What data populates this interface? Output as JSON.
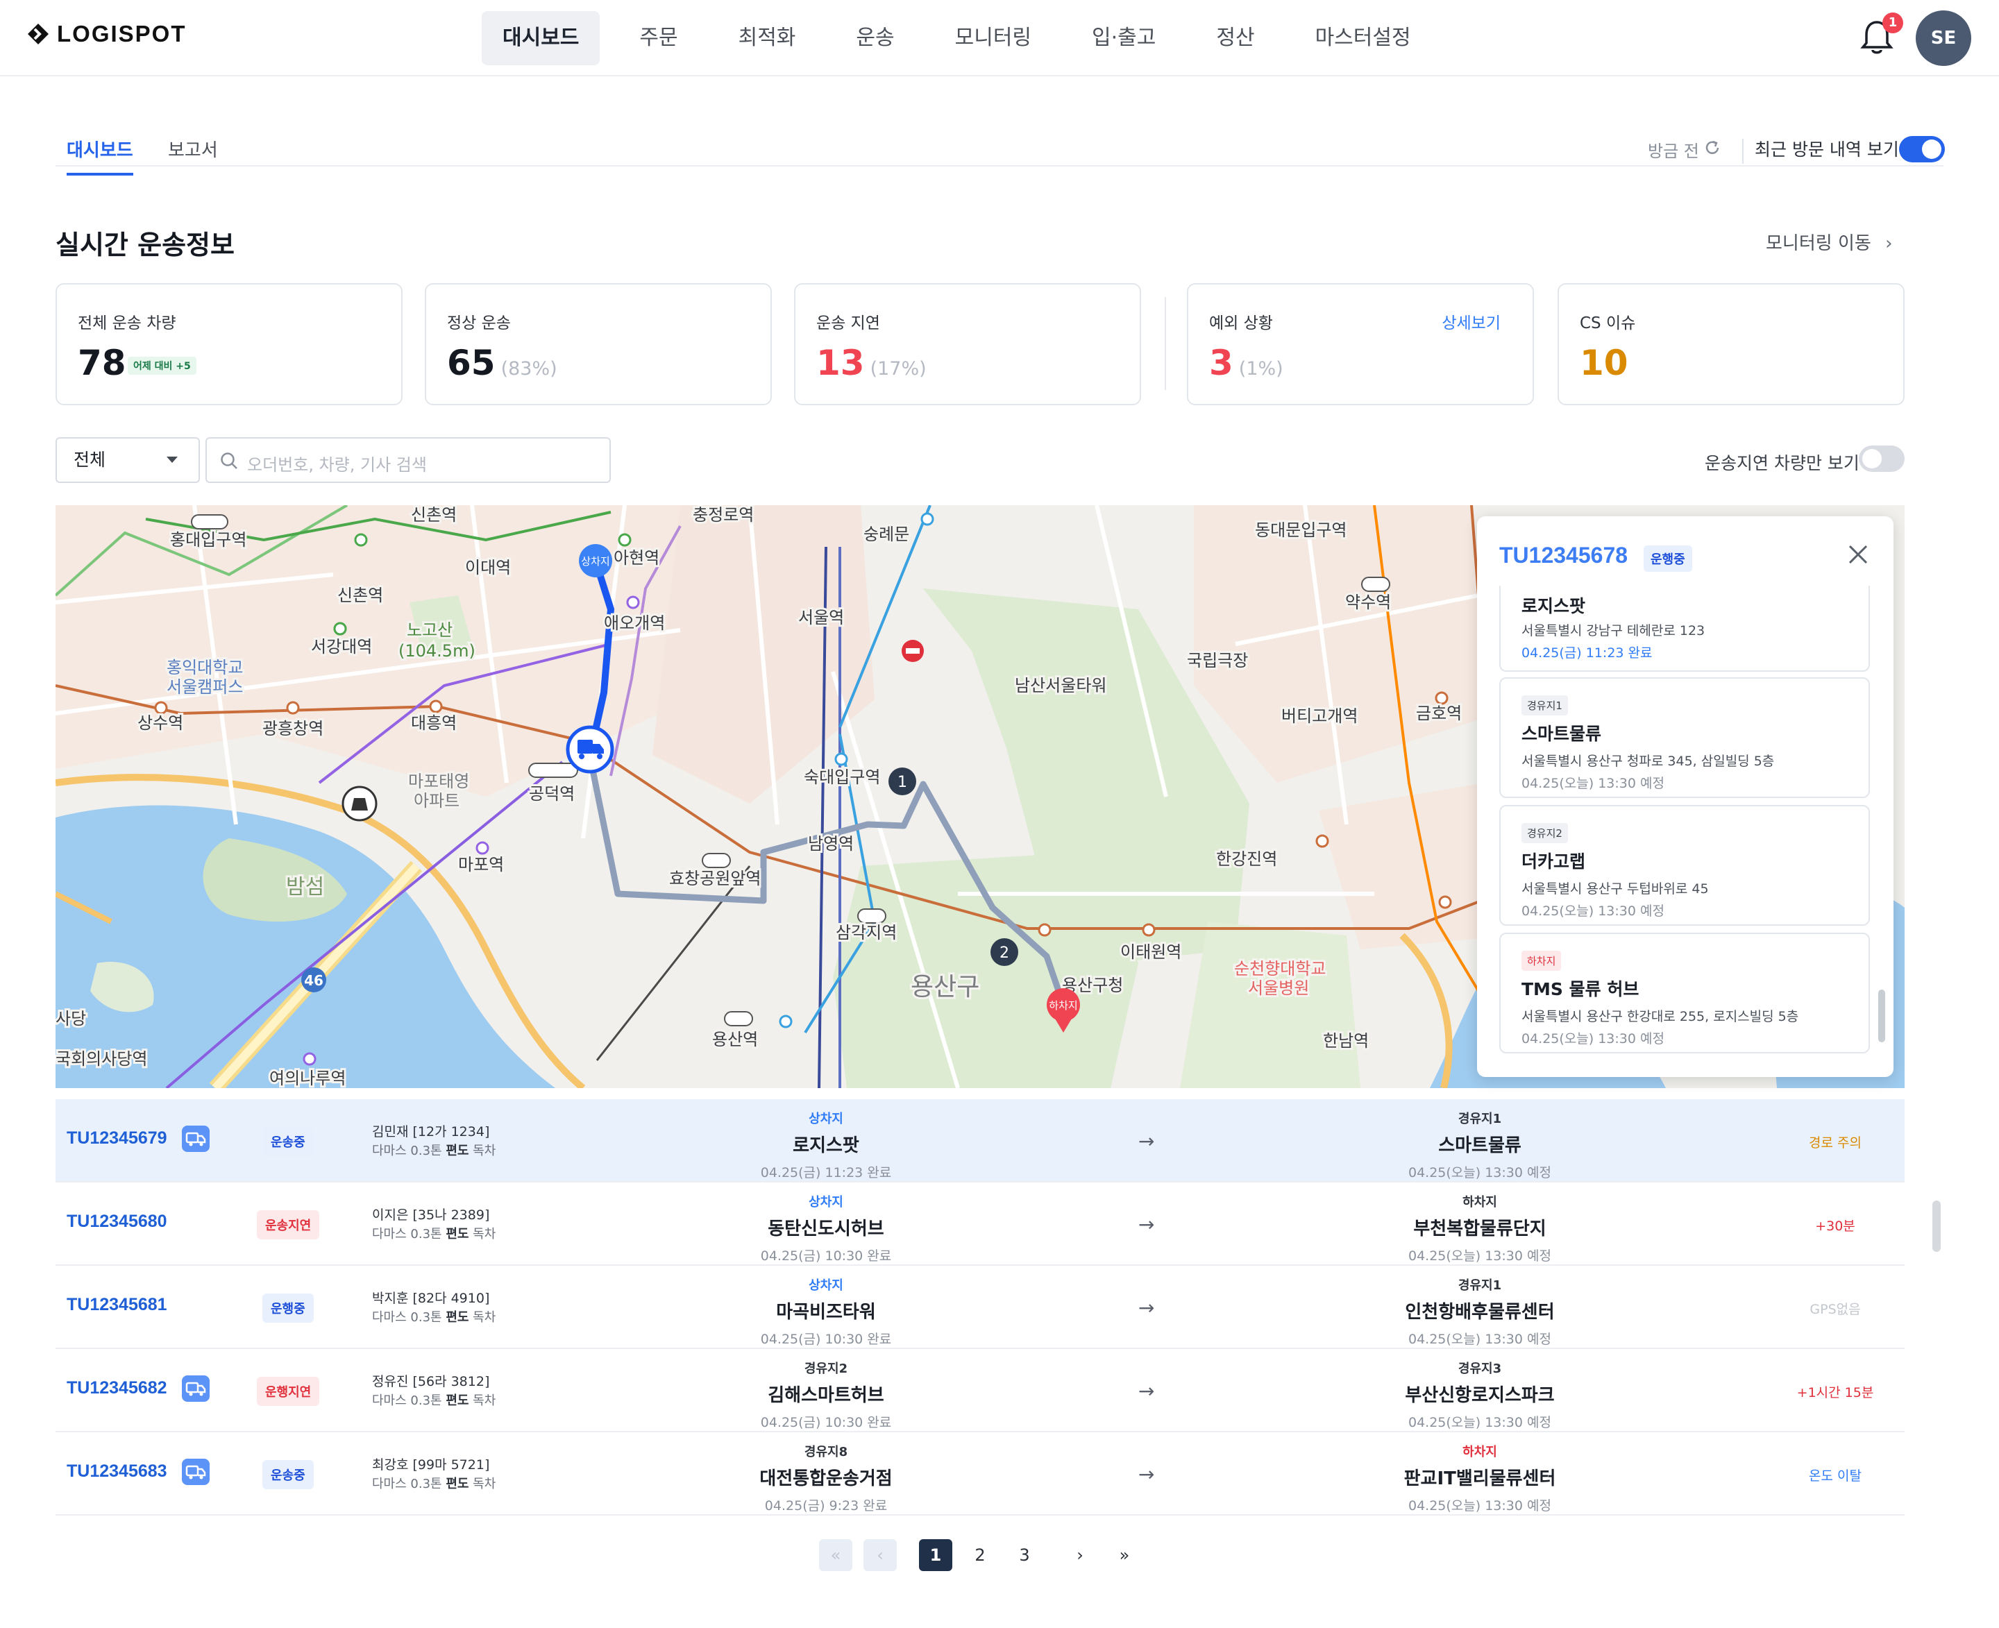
{
  "brand": {
    "name": "LOGISPOT"
  },
  "nav": {
    "items": [
      "대시보드",
      "주문",
      "최적화",
      "운송",
      "모니터링",
      "입·출고",
      "정산",
      "마스터설정"
    ],
    "notification_count": "1",
    "avatar_initials": "SE"
  },
  "subtabs": {
    "items": [
      "대시보드",
      "보고서"
    ],
    "active": "대시보드"
  },
  "refresh_label": "방금 전",
  "recent_visit": {
    "label": "최근 방문 내역 보기",
    "on": true
  },
  "section": {
    "title": "실시간 운송정보",
    "monitor_link": "모니터링 이동"
  },
  "kpis": {
    "total": {
      "label": "전체 운송 차량",
      "value": "78",
      "chip": "어제 대비 +5"
    },
    "normal": {
      "label": "정상 운송",
      "value": "65",
      "pct": "(83%)"
    },
    "delay": {
      "label": "운송 지연",
      "value": "13",
      "pct": "(17%)"
    },
    "exception": {
      "label": "예외 상황",
      "value": "3",
      "pct": "(1%)",
      "detail": "상세보기"
    },
    "cs": {
      "label": "CS 이슈",
      "value": "10"
    }
  },
  "filter": {
    "select": "전체",
    "search_placeholder": "오더번호, 차량, 기사 검색",
    "delay_only_label": "운송지연 차량만 보기",
    "delay_only_on": false
  },
  "map": {
    "labels": {
      "sinchon": "신촌역",
      "hongdae": "홍대입구역",
      "idae": "이대역",
      "sinchon2": "신촌역",
      "seogang": "서강대역",
      "nogosan": "노고산",
      "nogosan_h": "(104.5m)",
      "hongik": "홍익대학교",
      "hongik2": "서울캠퍼스",
      "sangsu": "상수역",
      "gwangheung": "광흥창역",
      "daeheung": "대흥역",
      "mapo_apt": "마포태영",
      "mapo_apt2": "아파트",
      "gongdeok": "공덕역",
      "bamseom": "밤섬",
      "mapo": "마포역",
      "yeouinaru": "여의나루역",
      "assembly": "국회의사당역",
      "sadang": "사당",
      "ahyeon": "아현역",
      "aeogae": "애오개역",
      "chungjeongno": "충정로역",
      "sungnyemun": "숭례문",
      "seoulst": "서울역",
      "sookmyung": "숙대입구역",
      "namyeong": "남영역",
      "hyochang": "효창공원앞역",
      "samgakji": "삼각지역",
      "yongsan": "용산역",
      "yongsangu": "용산구",
      "yongsangu_office": "용산구청",
      "itaewon": "이태원역",
      "namsan": "남산서울타워",
      "national_theater": "국립극장",
      "dongdaemun": "동대문입구역",
      "yaksu": "약수역",
      "beotigogae": "버티고개역",
      "geumho": "금호역",
      "hangangjin": "한강진역",
      "hannam": "한남역",
      "soonchunhyang": "순천향대학교",
      "soonchunhyang2": "서울병원",
      "line46": "46"
    },
    "markers": {
      "pickup": "상차지",
      "dropoff": "하차지",
      "stop1": "1",
      "stop2": "2"
    }
  },
  "panel": {
    "id": "TU12345678",
    "status": "운행중",
    "stops": [
      {
        "tag": "",
        "name": "로지스팟",
        "address": "서울특별시 강남구 테헤란로 123",
        "time": "04.25(금) 11:23 완료"
      },
      {
        "tag": "경유지1",
        "name": "스마트물류",
        "address": "서울특별시 용산구 청파로 345, 삼일빌딩 5층",
        "time": "04.25(오늘) 13:30 예정"
      },
      {
        "tag": "경유지2",
        "name": "더카고랩",
        "address": "서울특별시 용산구 두텁바위로 45",
        "time": "04.25(오늘) 13:30 예정"
      },
      {
        "tag": "하차지",
        "name": "TMS 물류 허브",
        "address": "서울특별시 용산구 한강대로 255, 로지스빌딩 5층",
        "time": "04.25(오늘) 13:30 예정"
      }
    ]
  },
  "rows": [
    {
      "id": "TU12345679",
      "status": "운송중",
      "driver": "김민재 [12가 1234]",
      "vehicle_a": "다마스 0.3톤 ",
      "vehicle_b": "편도",
      "vehicle_c": " 독차",
      "from_type": "상차지",
      "from_name": "로지스팟",
      "from_time": "04.25(금) 11:23 완료",
      "to_type": "경유지1",
      "to_name": "스마트물류",
      "to_time": "04.25(오늘) 13:30 예정",
      "note": "경로 주의"
    },
    {
      "id": "TU12345680",
      "status": "운송지연",
      "driver": "이지은 [35나 2389]",
      "vehicle_a": "다마스 0.3톤 ",
      "vehicle_b": "편도",
      "vehicle_c": " 독차",
      "from_type": "상차지",
      "from_name": "동탄신도시허브",
      "from_time": "04.25(금) 10:30 완료",
      "to_type": "하차지",
      "to_name": "부천복합물류단지",
      "to_time": "04.25(오늘) 13:30 예정",
      "note": "+30분"
    },
    {
      "id": "TU12345681",
      "status": "운행중",
      "driver": "박지훈 [82다 4910]",
      "vehicle_a": "다마스 0.3톤 ",
      "vehicle_b": "편도",
      "vehicle_c": " 독차",
      "from_type": "상차지",
      "from_name": "마곡비즈타워",
      "from_time": "04.25(금) 10:30 완료",
      "to_type": "경유지1",
      "to_name": "인천항배후물류센터",
      "to_time": "04.25(오늘) 13:30 예정",
      "note": "GPS없음"
    },
    {
      "id": "TU12345682",
      "status": "운행지연",
      "driver": "정유진 [56라 3812]",
      "vehicle_a": "다마스 0.3톤 ",
      "vehicle_b": "편도",
      "vehicle_c": " 독차",
      "from_type": "경유지2",
      "from_name": "김해스마트허브",
      "from_time": "04.25(금) 10:30 완료",
      "to_type": "경유지3",
      "to_name": "부산신항로지스파크",
      "to_time": "04.25(오늘) 13:30 예정",
      "note": "+1시간 15분"
    },
    {
      "id": "TU12345683",
      "status": "운송중",
      "driver": "최강호 [99마 5721]",
      "vehicle_a": "다마스 0.3톤 ",
      "vehicle_b": "편도",
      "vehicle_c": " 독차",
      "from_type": "경유지8",
      "from_name": "대전통합운송거점",
      "from_time": "04.25(금) 9:23 완료",
      "to_type": "하차지",
      "to_name": "판교IT밸리물류센터",
      "to_time": "04.25(오늘) 13:30 예정",
      "note": "온도 이탈"
    }
  ],
  "pagination": {
    "pages": [
      "1",
      "2",
      "3"
    ],
    "current": "1",
    "first": "«",
    "prev": "‹",
    "next": "›",
    "last": "»"
  },
  "colors": {
    "accent": "#2563eb",
    "danger": "#f04452",
    "warning": "#d98a00",
    "selected_row": "#e9f1fd"
  }
}
